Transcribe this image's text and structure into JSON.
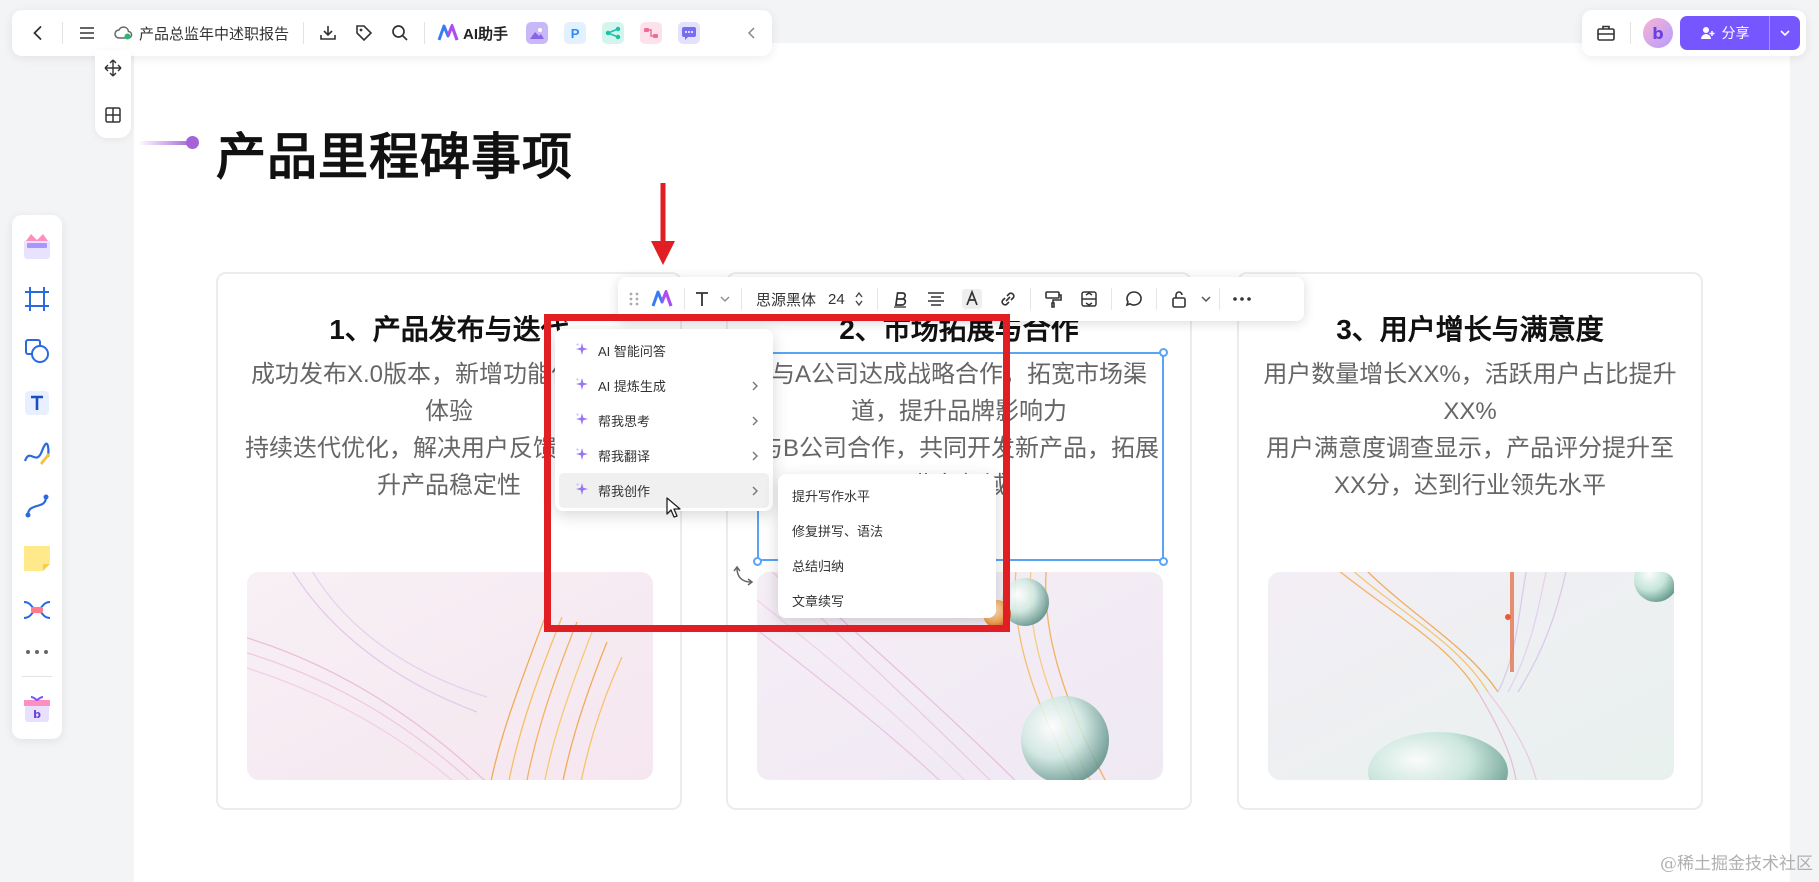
{
  "topbar": {
    "doc_title": "产品总监年中述职报告",
    "ai_label": "AI助手",
    "apps": [
      {
        "icon": "image-app-icon",
        "color": "#a98df5"
      },
      {
        "icon": "p-app-icon",
        "glyph": "P",
        "color": "#2a8cf0"
      },
      {
        "icon": "flow-app-icon",
        "color": "#18c2a2"
      },
      {
        "icon": "mindmap-app-icon",
        "color": "#f06a9a"
      },
      {
        "icon": "chat-app-icon",
        "color": "#7a6cf0"
      }
    ]
  },
  "topright": {
    "share_label": "分享"
  },
  "page": {
    "title": "产品里程碑事项"
  },
  "cards": [
    {
      "title": "1、产品发布与迭代",
      "body": "成功发布X.0版本，新增功能优化用户体验\n持续迭代优化，解决用户反馈问题，提升产品稳定性"
    },
    {
      "title": "2、市场拓展与合作",
      "body": "与A公司达成战略合作，拓宽市场渠道，提升品牌影响力\n与B公司合作，共同开发新产品，拓展业务领域"
    },
    {
      "title": "3、用户增长与满意度",
      "body": "用户数量增长XX%，活跃用户占比提升XX%\n用户满意度调查显示，产品评分提升至XX分，达到行业领先水平"
    }
  ],
  "text_toolbar": {
    "font_name": "思源黑体",
    "font_size": "24"
  },
  "ai_menu": {
    "items": [
      {
        "label": "AI 智能问答",
        "has_sub": false
      },
      {
        "label": "AI 提炼生成",
        "has_sub": true
      },
      {
        "label": "帮我思考",
        "has_sub": true
      },
      {
        "label": "帮我翻译",
        "has_sub": true
      },
      {
        "label": "帮我创作",
        "has_sub": true,
        "active": true
      }
    ],
    "sub_items": [
      "提升写作水平",
      "修复拼写、语法",
      "总结归纳",
      "文章续写"
    ]
  },
  "colors": {
    "accent": "#7657ff",
    "annotation_red": "#e01e24",
    "selection_blue": "#5aa4f5"
  },
  "watermark": "@稀土掘金技术社区"
}
